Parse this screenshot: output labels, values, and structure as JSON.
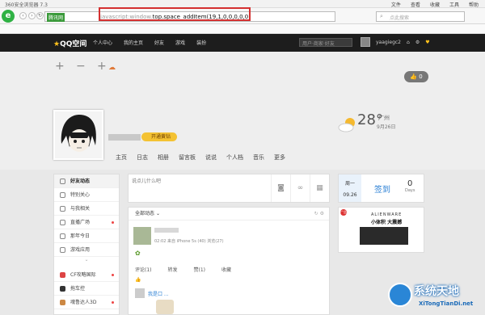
{
  "browser": {
    "title": "360安全浏览器 7.3",
    "menus": [
      "文件",
      "查看",
      "收藏",
      "工具",
      "帮助"
    ],
    "address": {
      "proto_badge": "腾讯网",
      "url_prefix": "javascript:window.",
      "url": "top.space_addItem(19,1,0,0,0,0,0)"
    },
    "search_placeholder": "点此搜索"
  },
  "qzone": {
    "logo": "QQ空间",
    "nav": [
      "个人中心",
      "我的主页",
      "好友",
      "游戏",
      "装扮"
    ],
    "search_placeholder": "用户·商家·好友",
    "user": "yaagiegc2"
  },
  "cover": {
    "like_count": "0",
    "vip_badge": "开通黄钻"
  },
  "weather": {
    "temp": "28°",
    "city": "广州",
    "date": "9月26日"
  },
  "profile_tabs": [
    "主页",
    "日志",
    "相册",
    "留言板",
    "说说",
    "个人档",
    "音乐",
    "更多"
  ],
  "left_menu": [
    {
      "label": "好友动态",
      "active": true
    },
    {
      "label": "特别关心",
      "active": false
    },
    {
      "label": "与我相关",
      "active": false
    },
    {
      "label": "直播广场",
      "active": false,
      "dot": true
    },
    {
      "label": "那年今日",
      "active": false
    },
    {
      "label": "游戏应用",
      "active": false
    }
  ],
  "left_menu_2": [
    {
      "label": "CF攻略国际",
      "dot": true
    },
    {
      "label": "拖车控",
      "dot": false
    },
    {
      "label": "魂鲁达人3D",
      "dot": true
    }
  ],
  "composer": {
    "placeholder": "说点儿什么吧"
  },
  "checkin": {
    "weekday": "周一",
    "date": "09.26",
    "label": "签到",
    "count": "0",
    "unit": "Days"
  },
  "feed": {
    "filter": "全部动态",
    "post_meta": "02:02 来自 iPhone 5s (40) 浏览(27)",
    "actions": [
      "评论(1)",
      "转发",
      "赞(1)",
      "收藏"
    ],
    "like_line": "我是口 ..."
  },
  "ad": {
    "brand": "ALIENWARE",
    "slogan": "小体积 大震撼",
    "tag": "广告"
  },
  "watermark": {
    "name": "系统天地",
    "url": "XiTongTianDi.net"
  }
}
